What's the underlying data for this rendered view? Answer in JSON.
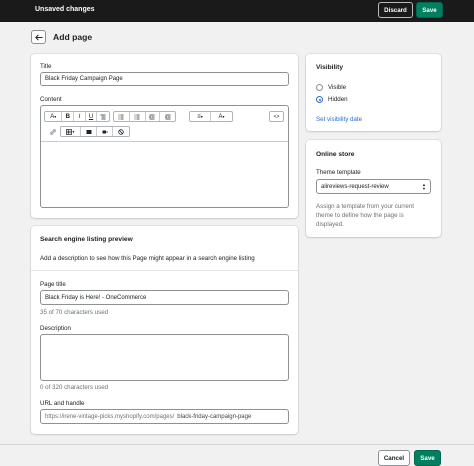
{
  "topbar": {
    "title": "Unsaved changes",
    "discard_label": "Discard",
    "save_label": "Save"
  },
  "page": {
    "title": "Add page"
  },
  "main": {
    "title_label": "Title",
    "title_value": "Black Friday Campaign Page",
    "content_label": "Content",
    "toolbar": {
      "font_glyph": "A",
      "bold": "B",
      "italic": "I",
      "underline": "U",
      "align_glyph": "≡",
      "color_glyph": "A",
      "html_glyph": "<>"
    }
  },
  "seo": {
    "title": "Search engine listing preview",
    "description": "Add a description to see how this Page might appear in a search engine listing",
    "page_title_label": "Page title",
    "page_title_value": "Black Friday is Here! - OneCommerce",
    "page_title_count": "35 of 70 characters used",
    "description_label": "Description",
    "description_value": "",
    "description_count": "0 of 320 characters used",
    "url_label": "URL and handle",
    "url_prefix": "https://irene-vintage-picks.myshopify.com/pages/",
    "url_handle": "black-friday-campaign-page"
  },
  "visibility": {
    "title": "Visibility",
    "options": [
      "Visible",
      "Hidden"
    ],
    "selected": "Hidden",
    "set_date_link": "Set visibility date"
  },
  "online_store": {
    "title": "Online store",
    "theme_label": "Theme template",
    "theme_value": "alireviews-request-review",
    "help": "Assign a template from your current theme to define how the page is displayed."
  },
  "footer": {
    "cancel_label": "Cancel",
    "save_label": "Save"
  },
  "colors": {
    "accent": "#008060",
    "link": "#2c6ecb",
    "topbar": "#1a1a1a"
  }
}
